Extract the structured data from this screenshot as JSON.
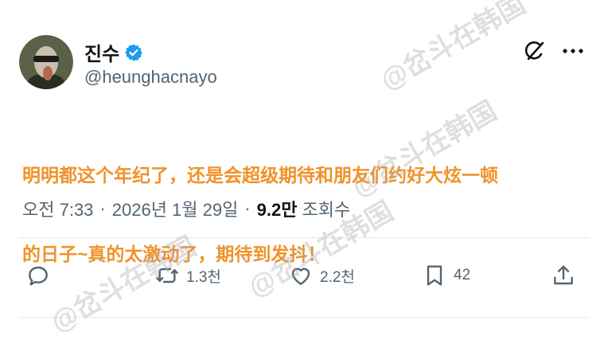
{
  "author": {
    "display_name": "진수",
    "handle": "@heunghacnayo"
  },
  "tweet": {
    "text_line1": "明明都这个年纪了，还是会超级期待和朋友们约好大炫一顿",
    "text_line2": "的日子~真的太激动了，期待到发抖！",
    "time": "오전 7:33",
    "date": "2026년 1월 29일",
    "separator": "·",
    "views": "9.2만",
    "views_label": "조회수"
  },
  "actions": {
    "retweets": "1.3천",
    "likes": "2.2천",
    "bookmarks": "42"
  },
  "watermark": {
    "text": "@岔斗在韩国"
  },
  "colors": {
    "verified": "#1d9bf0",
    "text_overlay": "#f0922a",
    "secondary": "#536471"
  }
}
